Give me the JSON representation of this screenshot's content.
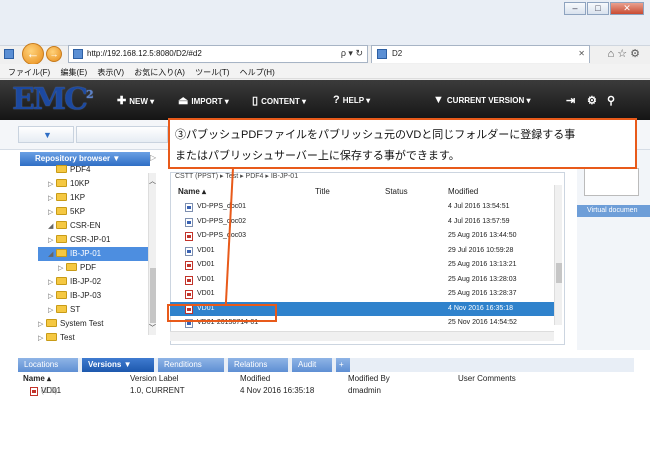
{
  "browser": {
    "url": "http://192.168.12.5:8080/D2/#d2",
    "tab_title": "D2",
    "menu": [
      "ファイル(F)",
      "編集(E)",
      "表示(V)",
      "お気に入り(A)",
      "ツール(T)",
      "ヘルプ(H)"
    ]
  },
  "header": {
    "logo": "EMC",
    "logo_sup": "2",
    "menu": [
      {
        "label": "NEW",
        "icon": "plus-icon"
      },
      {
        "label": "IMPORT",
        "icon": "upload-icon"
      },
      {
        "label": "CONTENT",
        "icon": "document-icon"
      },
      {
        "label": "HELP",
        "icon": "help-icon"
      },
      {
        "label": "CURRENT VERSION",
        "icon": "filter-icon"
      }
    ]
  },
  "callout": {
    "line1": "③パブッシュPDFファイルをパブリッシュ元のVDと同じフォルダーに登録する事",
    "line2": "またはパブリッシュサーバー上に保存する事ができます。"
  },
  "repository": {
    "title": "Repository browser ▼",
    "tree": [
      {
        "label": "PDF4",
        "indent": 1,
        "twisty": ""
      },
      {
        "label": "10KP",
        "indent": 1,
        "twisty": "▷"
      },
      {
        "label": "1KP",
        "indent": 1,
        "twisty": "▷"
      },
      {
        "label": "5KP",
        "indent": 1,
        "twisty": "▷"
      },
      {
        "label": "CSR-EN",
        "indent": 1,
        "twisty": "◢"
      },
      {
        "label": "CSR-JP-01",
        "indent": 1,
        "twisty": "▷"
      },
      {
        "label": "IB-JP-01",
        "indent": 1,
        "twisty": "◢",
        "selected": true
      },
      {
        "label": "PDF",
        "indent": 2,
        "twisty": "▷"
      },
      {
        "label": "IB-JP-02",
        "indent": 1,
        "twisty": "▷"
      },
      {
        "label": "IB-JP-03",
        "indent": 1,
        "twisty": "▷"
      },
      {
        "label": "ST",
        "indent": 1,
        "twisty": "▷"
      },
      {
        "label": "System Test",
        "indent": 0,
        "twisty": "▷"
      },
      {
        "label": "Test",
        "indent": 0,
        "twisty": "▷"
      }
    ]
  },
  "list": {
    "breadcrumb": "CSTT (PPST)  ▸ Test ▸ PDF4 ▸ IB-JP-01",
    "columns": {
      "name": "Name ▴",
      "title": "Title",
      "status": "Status",
      "modified": "Modified"
    },
    "rows": [
      {
        "name": "VD-PPS_doc01",
        "modified": "4 Jul 2016 13:54:51",
        "icon": "doc"
      },
      {
        "name": "VD-PPS_doc02",
        "modified": "4 Jul 2016 13:57:59",
        "icon": "doc"
      },
      {
        "name": "VD-PPS_doc03",
        "modified": "25 Aug 2016 13:44:50",
        "icon": "pdf"
      },
      {
        "name": "VD01",
        "modified": "29 Jul 2016 10:59:28",
        "icon": "doc"
      },
      {
        "name": "VD01",
        "modified": "25 Aug 2016 13:13:21",
        "icon": "pdf"
      },
      {
        "name": "VD01",
        "modified": "25 Aug 2016 13:28:03",
        "icon": "pdf"
      },
      {
        "name": "VD01",
        "modified": "25 Aug 2016 13:28:37",
        "icon": "pdf"
      },
      {
        "name": "VD01",
        "modified": "4 Nov 2016 16:35:18",
        "icon": "pdf",
        "selected": true
      },
      {
        "name": "VD01-20150714-01",
        "modified": "25 Nov 2016 14:54:52",
        "icon": "doc"
      }
    ]
  },
  "right_panel": {
    "virtual_doc": "Virtual documen"
  },
  "bottom": {
    "tabs": [
      "Locations",
      "Versions ▼",
      "Renditions",
      "Relations",
      "Audit",
      "+"
    ],
    "headers": {
      "name": "Name ▴",
      "version": "Version Label",
      "modified": "Modified",
      "modified_by": "Modified By",
      "comments": "User Comments"
    },
    "row": {
      "name": "VD01",
      "version_suffix": "(1.0)",
      "version": "1.0, CURRENT",
      "modified": "4 Nov 2016 16:35:18",
      "modified_by": "dmadmin",
      "comments": ""
    }
  },
  "colors": {
    "accent": "#e85a1a",
    "selection": "#2f82cc",
    "tab_blue": "#5e8fd3"
  }
}
